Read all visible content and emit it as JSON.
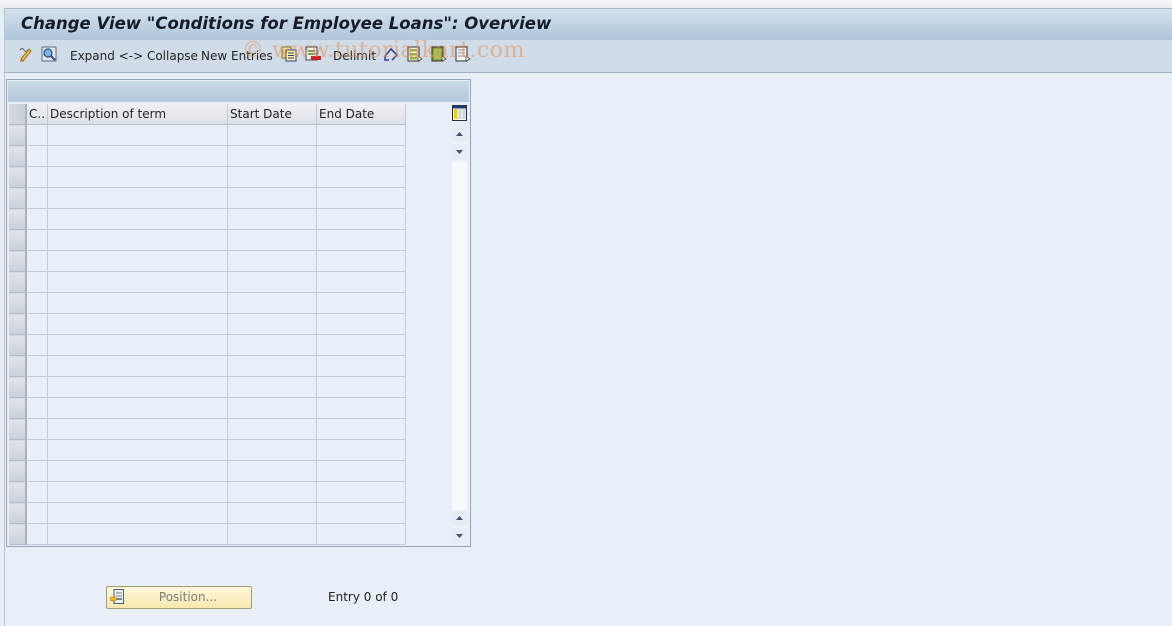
{
  "window": {
    "title": "Change View \"Conditions for Employee Loans\": Overview"
  },
  "toolbar": {
    "items": [
      {
        "icon": "display-change-icon"
      },
      {
        "icon": "details-icon"
      },
      {
        "label": "Expand <-> Collapse"
      },
      {
        "label": "New Entries"
      },
      {
        "icon": "copy-as-icon"
      },
      {
        "icon": "delete-icon"
      },
      {
        "label": "Delimit"
      },
      {
        "icon": "undo-change-icon"
      },
      {
        "icon": "select-all-icon"
      },
      {
        "icon": "select-block-icon"
      },
      {
        "icon": "deselect-all-icon"
      }
    ],
    "expand_label": "Expand <-> Collapse",
    "new_entries_label": "New Entries",
    "delimit_label": "Delimit"
  },
  "watermark": "© www.tutorialkart.com",
  "table": {
    "columns": [
      "C..",
      "Description of term",
      "Start Date",
      "End Date"
    ],
    "row_count": 20,
    "rows": []
  },
  "footer": {
    "position_button": "Position...",
    "entry_text": "Entry 0 of 0"
  }
}
